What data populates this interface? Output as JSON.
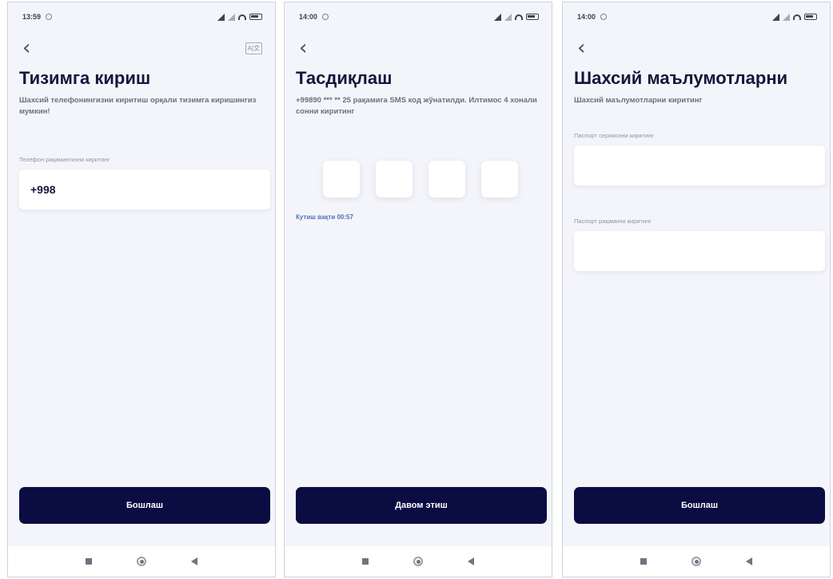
{
  "screens": [
    {
      "status_time": "13:59",
      "title": "Тизимга кириш",
      "subtitle": "Шахсий телефонингизни киритиш орқали тизимга киришингиз мумкин!",
      "phone_label": "Телефон рақамингизни киритинг",
      "phone_value": "+998",
      "button": "Бошлаш"
    },
    {
      "status_time": "14:00",
      "title": "Тасдиқлаш",
      "subtitle": "+99890 *** ** 25 рақамига SMS код жўнатилди. Илтимос 4 хонали сонни киритинг",
      "timer": "Кутиш вақти 00:57",
      "button": "Давом этиш"
    },
    {
      "status_time": "14:00",
      "title": "Шахсий маълумотларни",
      "subtitle": "Шахсий маълумотларни киритинг",
      "passport_series_label": "Паспорт сериясини киритинг",
      "passport_number_label": "Паспорт рақамини киритинг",
      "button": "Бошлаш"
    }
  ],
  "icons": {
    "back": "chevron-left-icon",
    "language": "translate-icon",
    "alarm": "alarm-icon",
    "signal": "signal-icon",
    "wifi": "wifi-icon",
    "battery": "battery-icon",
    "nav_recent": "recent-apps-icon",
    "nav_home": "home-icon",
    "nav_back": "back-triangle-icon"
  },
  "colors": {
    "primary_button": "#0a0c42",
    "background": "#f4f5fa",
    "title": "#14163b",
    "timer": "#4f72b8"
  }
}
